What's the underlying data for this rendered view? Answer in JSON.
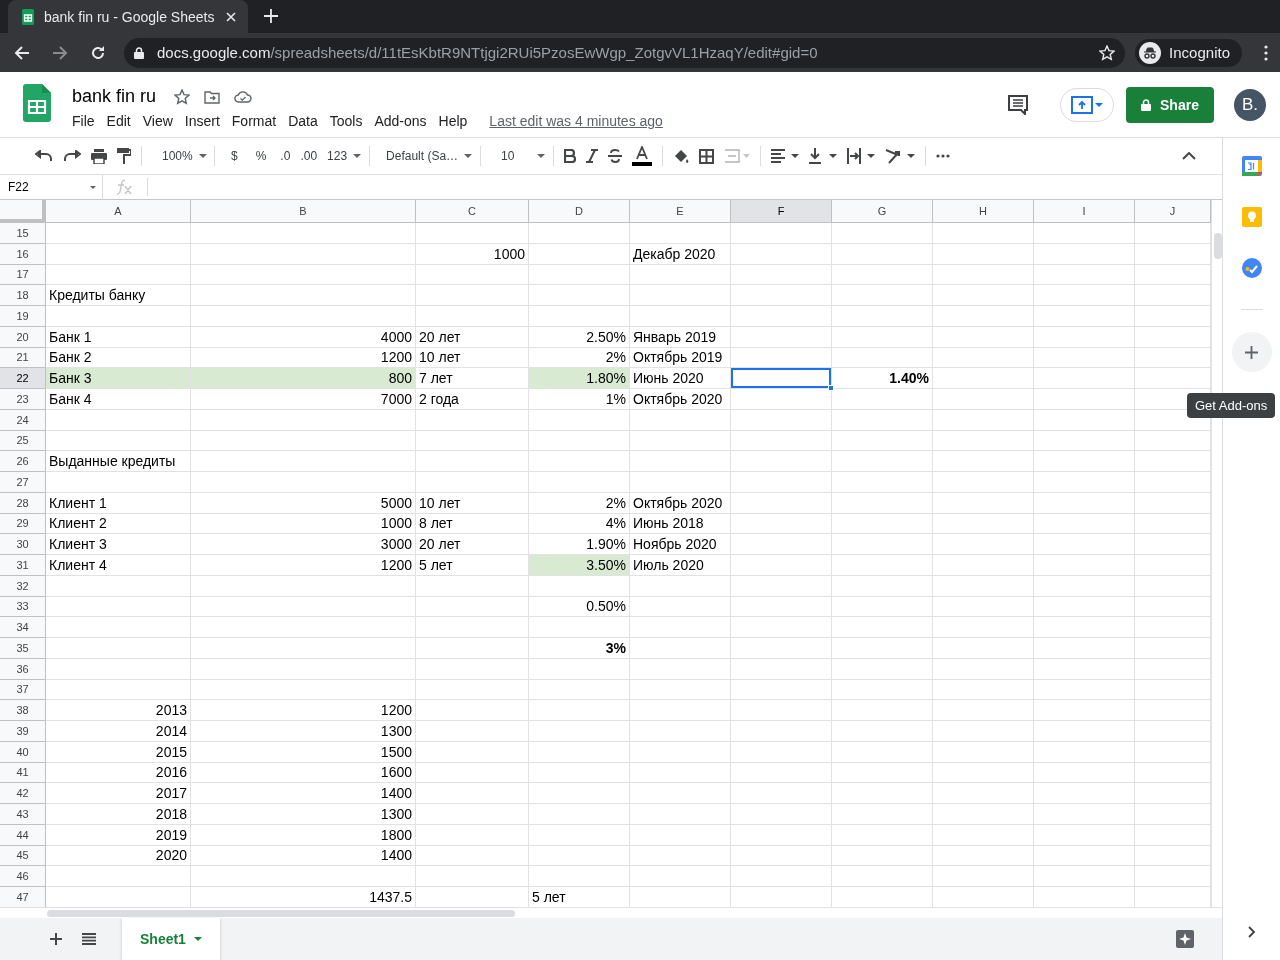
{
  "browser": {
    "tab_title": "bank fin ru - Google Sheets",
    "url_host": "docs.google.com",
    "url_path": "/spreadsheets/d/11tEsKbtR9NTtjgi2RUi5PzosEwWgp_ZotgvVL1HzaqY/edit#gid=0",
    "profile": "Incognito"
  },
  "document": {
    "title": "bank fin ru",
    "menu": [
      "File",
      "Edit",
      "View",
      "Insert",
      "Format",
      "Data",
      "Tools",
      "Add-ons",
      "Help"
    ],
    "last_edit": "Last edit was 4 minutes ago",
    "share": "Share",
    "avatar": "B."
  },
  "toolbar": {
    "zoom": "100%",
    "currency": "$",
    "percent": "%",
    "decrease_decimal": ".0",
    "increase_decimal": ".00",
    "more_formats": "123",
    "font": "Default (Sa…",
    "font_size": "10"
  },
  "formula_bar": {
    "cell_ref": "F22"
  },
  "grid": {
    "columns": [
      {
        "label": "A",
        "selected": false
      },
      {
        "label": "B",
        "selected": false
      },
      {
        "label": "C",
        "selected": false
      },
      {
        "label": "D",
        "selected": false
      },
      {
        "label": "E",
        "selected": false
      },
      {
        "label": "F",
        "selected": true
      },
      {
        "label": "G",
        "selected": false
      },
      {
        "label": "H",
        "selected": false
      },
      {
        "label": "I",
        "selected": false
      },
      {
        "label": "J",
        "selected": false
      }
    ],
    "rows": [
      {
        "number": "15",
        "selected": false
      },
      {
        "number": "16",
        "selected": false,
        "cells": {
          "C": {
            "kind": "number",
            "text": "1000"
          },
          "E": {
            "kind": "text",
            "text": "Декабр 2020"
          }
        }
      },
      {
        "number": "17",
        "selected": false
      },
      {
        "number": "18",
        "selected": false,
        "cells": {
          "A": {
            "kind": "text",
            "text": "Кредиты банку"
          }
        }
      },
      {
        "number": "19",
        "selected": false
      },
      {
        "number": "20",
        "selected": false,
        "cells": {
          "A": {
            "kind": "text",
            "text": "Банк 1"
          },
          "B": {
            "kind": "number",
            "text": "4000"
          },
          "C": {
            "kind": "text",
            "text": "20 лет"
          },
          "D": {
            "kind": "number",
            "text": "2.50%"
          },
          "E": {
            "kind": "text",
            "text": "Январь 2019"
          }
        }
      },
      {
        "number": "21",
        "selected": false,
        "cells": {
          "A": {
            "kind": "text",
            "text": "Банк 2"
          },
          "B": {
            "kind": "number",
            "text": "1200"
          },
          "C": {
            "kind": "text",
            "text": "10 лет"
          },
          "D": {
            "kind": "number",
            "text": "2%"
          },
          "E": {
            "kind": "text",
            "text": "Октябрь 2019"
          }
        }
      },
      {
        "number": "22",
        "selected": true,
        "cells": {
          "A": {
            "kind": "text",
            "text": "Банк 3",
            "highlighted": true
          },
          "B": {
            "kind": "number",
            "text": "800",
            "highlighted": true
          },
          "C": {
            "kind": "text",
            "text": "7 лет"
          },
          "D": {
            "kind": "number",
            "text": "1.80%",
            "highlighted": true
          },
          "E": {
            "kind": "text",
            "text": "Июнь 2020"
          },
          "G": {
            "kind": "number",
            "text": "1.40%",
            "bold": true
          }
        }
      },
      {
        "number": "23",
        "selected": false,
        "cells": {
          "A": {
            "kind": "text",
            "text": "Банк 4"
          },
          "B": {
            "kind": "number",
            "text": "7000"
          },
          "C": {
            "kind": "text",
            "text": "2 года"
          },
          "D": {
            "kind": "number",
            "text": "1%"
          },
          "E": {
            "kind": "text",
            "text": "Октябрь 2020"
          }
        }
      },
      {
        "number": "24",
        "selected": false
      },
      {
        "number": "25",
        "selected": false
      },
      {
        "number": "26",
        "selected": false,
        "cells": {
          "A": {
            "kind": "text",
            "text": "Выданные кредиты"
          }
        }
      },
      {
        "number": "27",
        "selected": false
      },
      {
        "number": "28",
        "selected": false,
        "cells": {
          "A": {
            "kind": "text",
            "text": "Клиент 1"
          },
          "B": {
            "kind": "number",
            "text": "5000"
          },
          "C": {
            "kind": "text",
            "text": "10 лет"
          },
          "D": {
            "kind": "number",
            "text": "2%"
          },
          "E": {
            "kind": "text",
            "text": "Октябрь 2020"
          }
        }
      },
      {
        "number": "29",
        "selected": false,
        "cells": {
          "A": {
            "kind": "text",
            "text": "Клиент 2"
          },
          "B": {
            "kind": "number",
            "text": "1000"
          },
          "C": {
            "kind": "text",
            "text": "8 лет"
          },
          "D": {
            "kind": "number",
            "text": "4%"
          },
          "E": {
            "kind": "text",
            "text": "Июнь 2018"
          }
        }
      },
      {
        "number": "30",
        "selected": false,
        "cells": {
          "A": {
            "kind": "text",
            "text": "Клиент 3"
          },
          "B": {
            "kind": "number",
            "text": "3000"
          },
          "C": {
            "kind": "text",
            "text": "20 лет"
          },
          "D": {
            "kind": "number",
            "text": "1.90%"
          },
          "E": {
            "kind": "text",
            "text": "Ноябрь 2020"
          }
        }
      },
      {
        "number": "31",
        "selected": false,
        "cells": {
          "A": {
            "kind": "text",
            "text": "Клиент 4"
          },
          "B": {
            "kind": "number",
            "text": "1200"
          },
          "C": {
            "kind": "text",
            "text": "5 лет"
          },
          "D": {
            "kind": "number",
            "text": "3.50%",
            "highlighted": true
          },
          "E": {
            "kind": "text",
            "text": "Июль 2020"
          }
        }
      },
      {
        "number": "32",
        "selected": false
      },
      {
        "number": "33",
        "selected": false,
        "cells": {
          "D": {
            "kind": "number",
            "text": "0.50%"
          }
        }
      },
      {
        "number": "34",
        "selected": false
      },
      {
        "number": "35",
        "selected": false,
        "cells": {
          "D": {
            "kind": "number",
            "text": "3%",
            "bold": true
          }
        }
      },
      {
        "number": "36",
        "selected": false
      },
      {
        "number": "37",
        "selected": false
      },
      {
        "number": "38",
        "selected": false,
        "cells": {
          "A": {
            "kind": "number",
            "text": "2013"
          },
          "B": {
            "kind": "number",
            "text": "1200"
          }
        }
      },
      {
        "number": "39",
        "selected": false,
        "cells": {
          "A": {
            "kind": "number",
            "text": "2014"
          },
          "B": {
            "kind": "number",
            "text": "1300"
          }
        }
      },
      {
        "number": "40",
        "selected": false,
        "cells": {
          "A": {
            "kind": "number",
            "text": "2015"
          },
          "B": {
            "kind": "number",
            "text": "1500"
          }
        }
      },
      {
        "number": "41",
        "selected": false,
        "cells": {
          "A": {
            "kind": "number",
            "text": "2016"
          },
          "B": {
            "kind": "number",
            "text": "1600"
          }
        }
      },
      {
        "number": "42",
        "selected": false,
        "cells": {
          "A": {
            "kind": "number",
            "text": "2017"
          },
          "B": {
            "kind": "number",
            "text": "1400"
          }
        }
      },
      {
        "number": "43",
        "selected": false,
        "cells": {
          "A": {
            "kind": "number",
            "text": "2018"
          },
          "B": {
            "kind": "number",
            "text": "1300"
          }
        }
      },
      {
        "number": "44",
        "selected": false,
        "cells": {
          "A": {
            "kind": "number",
            "text": "2019"
          },
          "B": {
            "kind": "number",
            "text": "1800"
          }
        }
      },
      {
        "number": "45",
        "selected": false,
        "cells": {
          "A": {
            "kind": "number",
            "text": "2020"
          },
          "B": {
            "kind": "number",
            "text": "1400"
          }
        }
      },
      {
        "number": "46",
        "selected": false
      },
      {
        "number": "47",
        "selected": false,
        "cells": {
          "B": {
            "kind": "number",
            "text": "1437.5"
          },
          "D": {
            "kind": "text",
            "text": "5 лет"
          }
        }
      }
    ]
  },
  "side_panel": {
    "tooltip": "Get Add-ons"
  },
  "sheets": [
    {
      "label": "Sheet1",
      "selected": true
    }
  ]
}
